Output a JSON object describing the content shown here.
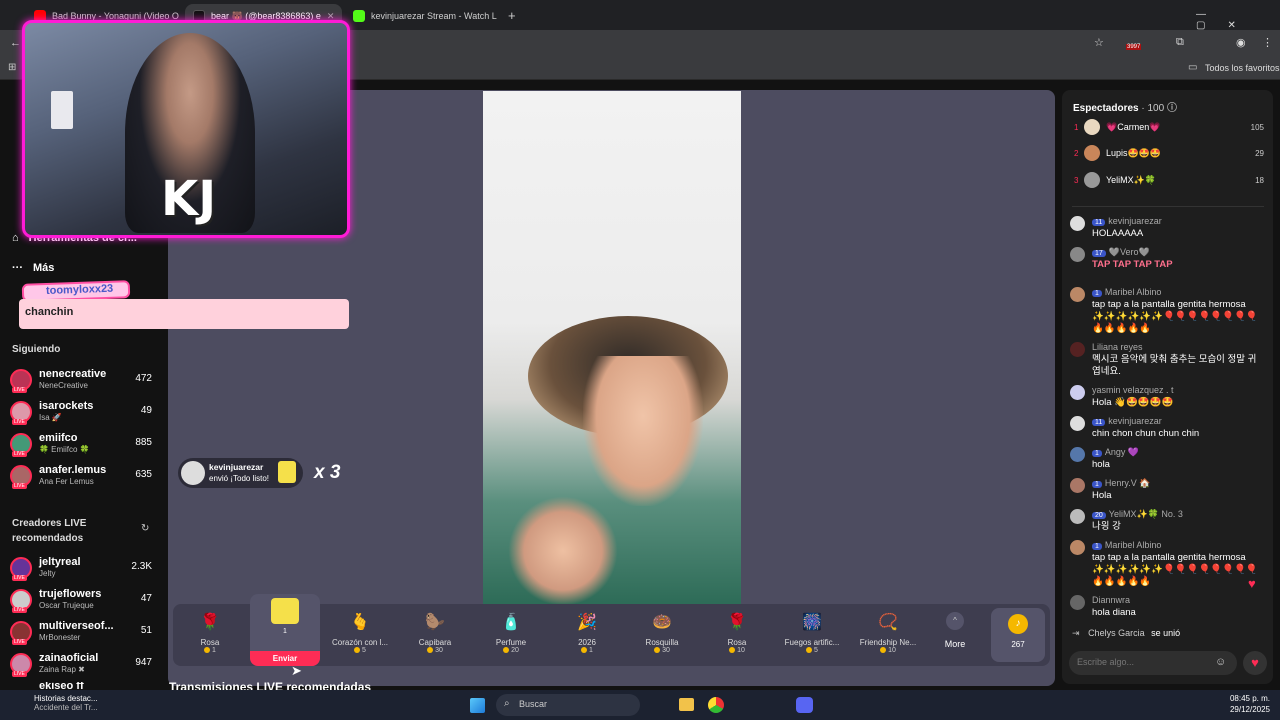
{
  "browser": {
    "tabs": [
      {
        "title": "Bad Bunny - Yonaguni (Video O",
        "color": "#ff0000"
      },
      {
        "title": "bear 🐻 (@bear8386863) e",
        "color": "#ffffff"
      },
      {
        "title": "kevinjuarezar Stream - Watch L",
        "color": "#53fc18"
      }
    ],
    "new_tab": "+",
    "bookmarks_label": "Todos los favoritos",
    "extension_count": "3997"
  },
  "left_nav": {
    "tools_label": "Herramientas de cr...",
    "more_label": "Más",
    "following_title": "Siguiendo",
    "following": [
      {
        "name": "nenecreative",
        "sub": "NeneCreative",
        "count": "472"
      },
      {
        "name": "isarockets",
        "sub": "Isa 🚀",
        "count": "49"
      },
      {
        "name": "emiifco",
        "sub": "🍀 Emiifco 🍀",
        "count": "885"
      },
      {
        "name": "anafer.lemus",
        "sub": "Ana Fer Lemus",
        "count": "635"
      }
    ],
    "recommended_title": "Creadores LIVE recomendados",
    "recommended": [
      {
        "name": "jeltyreal",
        "sub": "Jelty",
        "count": "2.3K"
      },
      {
        "name": "trujeflowers",
        "sub": "Oscar Trujeque",
        "count": "47"
      },
      {
        "name": "multiverseof...",
        "sub": "MrBonester",
        "count": "51"
      },
      {
        "name": "zainaoficial",
        "sub": "Zaina Rap ✖",
        "count": "947"
      },
      {
        "name": "ekiseo ff",
        "sub": "",
        "count": ""
      }
    ],
    "live_badge": "LIVE"
  },
  "overlay": {
    "cam_logo": "KJ",
    "chat_user": "toomyloxx23",
    "chat_text": "chanchin"
  },
  "gift_alert": {
    "user": "kevinjuarezar",
    "text": "envió ¡Todo listo!",
    "multiplier": "x 3"
  },
  "gifts": [
    {
      "name": "Rosa",
      "price": "1",
      "icon": "🌹"
    },
    {
      "name": "",
      "price": "1",
      "icon": "🧽"
    },
    {
      "name": "Corazón con l...",
      "price": "5",
      "icon": "🫰"
    },
    {
      "name": "Capibara",
      "price": "30",
      "icon": "🦫"
    },
    {
      "name": "Perfume",
      "price": "20",
      "icon": "🧴"
    },
    {
      "name": "2026",
      "price": "1",
      "icon": "🎉"
    },
    {
      "name": "Rosquilla",
      "price": "30",
      "icon": "🍩"
    },
    {
      "name": "Rosa",
      "price": "10",
      "icon": "🌹"
    },
    {
      "name": "Fuegos artific...",
      "price": "5",
      "icon": "🎆"
    },
    {
      "name": "Friendship Ne...",
      "price": "10",
      "icon": "📿"
    }
  ],
  "gift_send_label": "Enviar",
  "more_label": "More",
  "coins_label": "267",
  "recommended_section": "Transmisiones LIVE recomendadas",
  "chat": {
    "viewers_title": "Espectadores",
    "viewers_count": "· 100",
    "top_viewers": [
      {
        "rank": "1",
        "name": "💗Carmen💗",
        "count": "105"
      },
      {
        "rank": "2",
        "name": "Lupis🤩🤩🤩",
        "count": "29"
      },
      {
        "rank": "3",
        "name": "YeliMX✨🍀",
        "count": "18"
      }
    ],
    "messages": [
      {
        "user": "kevinjuarezar",
        "badge": "11",
        "text": "HOLAAAAA"
      },
      {
        "user": "🩶Vero🩶",
        "badge": "17",
        "text": "TAP TAP TAP TAP"
      },
      {
        "user": "Maribel Albino",
        "badge": "1",
        "text": "tap tap a la pantalla gentita hermosa ✨✨✨✨✨✨🎈🎈🎈🎈🎈🎈🎈🎈🔥🔥🔥🔥🔥"
      },
      {
        "user": "Liliana reyes",
        "badge": "",
        "text": "멕시코 음악에 맞춰 춤추는 모습이 정말 귀엽네요."
      },
      {
        "user": "yasmin velazquez . t",
        "badge": "",
        "text": "Hola 👋🤩🤩🤩🤩"
      },
      {
        "user": "kevinjuarezar",
        "badge": "11",
        "text": "chin chon chun chun chin"
      },
      {
        "user": "Angy 💜",
        "badge": "1",
        "text": "hola"
      },
      {
        "user": "Henry.V 🏠",
        "badge": "1",
        "text": "Hola"
      },
      {
        "user": "YeliMX✨🍀 No. 3",
        "badge": "20",
        "text": "나읭 강"
      },
      {
        "user": "Maribel Albino",
        "badge": "1",
        "text": "tap tap a la pantalla gentita hermosa ✨✨✨✨✨✨🎈🎈🎈🎈🎈🎈🎈🎈🔥🔥🔥🔥🔥"
      },
      {
        "user": "Diannwra",
        "badge": "",
        "text": "hola diana"
      }
    ],
    "join_user": "Chelys Garcia",
    "join_text": "se unió",
    "input_placeholder": "Escribe algo..."
  },
  "taskbar": {
    "news_title": "Historias destac...",
    "news_sub": "Accidente del Tr...",
    "search_placeholder": "Buscar",
    "time": "08:45 p. m.",
    "date": "29/12/2025"
  }
}
